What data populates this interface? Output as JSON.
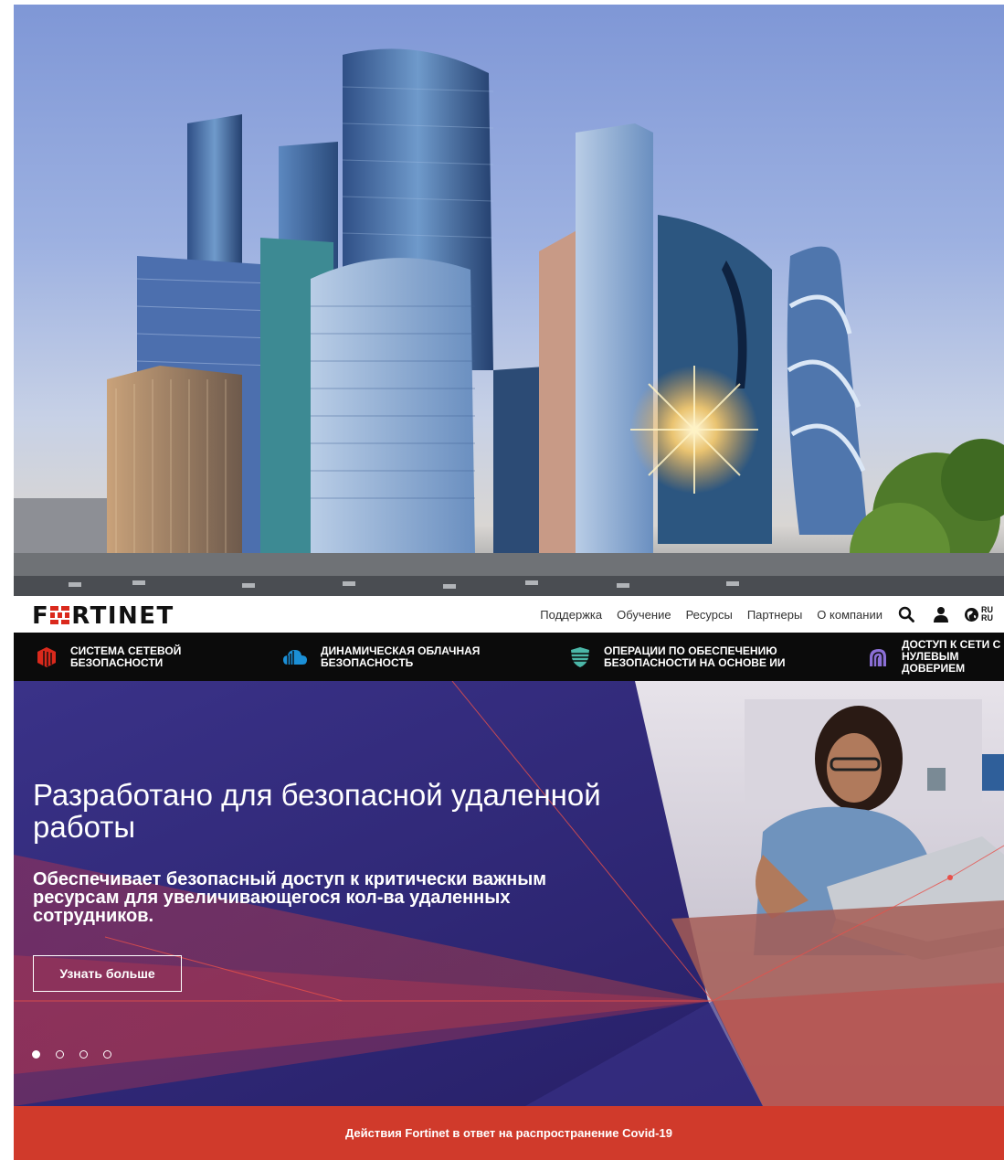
{
  "photo": {
    "alt": "Moscow City skyline"
  },
  "header": {
    "logo_text": "FORTINET",
    "nav": [
      {
        "label": "Поддержка"
      },
      {
        "label": "Обучение"
      },
      {
        "label": "Ресурсы"
      },
      {
        "label": "Партнеры"
      },
      {
        "label": "О компании"
      }
    ],
    "lang_top": "RU",
    "lang_bottom": "RU"
  },
  "products": [
    {
      "label_line1": "СИСТЕМА СЕТЕВОЙ",
      "label_line2": "БЕЗОПАСНОСТИ",
      "icon": "network-security-icon",
      "color": "#da291c"
    },
    {
      "label_line1": "ДИНАМИЧЕСКАЯ ОБЛАЧНАЯ",
      "label_line2": "БЕЗОПАСНОСТЬ",
      "icon": "cloud-security-icon",
      "color": "#1b8fd6"
    },
    {
      "label_line1": "ОПЕРАЦИИ ПО ОБЕСПЕЧЕНИЮ",
      "label_line2": "БЕЗОПАСНОСТИ НА ОСНОВЕ ИИ",
      "icon": "ai-operations-shield-icon",
      "color": "#4bb7a8"
    },
    {
      "label_line1": "ДОСТУП К СЕТИ С",
      "label_line2": "НУЛЕВЫМ ДОВЕРИЕМ",
      "icon": "zero-trust-icon",
      "color": "#8b6fd6"
    }
  ],
  "hero": {
    "title": "Разработано для безопасной удаленной работы",
    "subtitle": "Обеспечивает безопасный доступ к критически важным ресурсам для увеличивающегося кол-ва удаленных сотрудников.",
    "button_label": "Узнать больше",
    "slides_total": 4,
    "active_slide": 1
  },
  "banner": {
    "text": "Действия Fortinet в ответ на распространение Covid-19"
  },
  "colors": {
    "brand_red": "#da291c",
    "hero_purple": "#2a2370",
    "banner_red": "#d03a2b",
    "prod_bar": "#0b0b0b"
  }
}
